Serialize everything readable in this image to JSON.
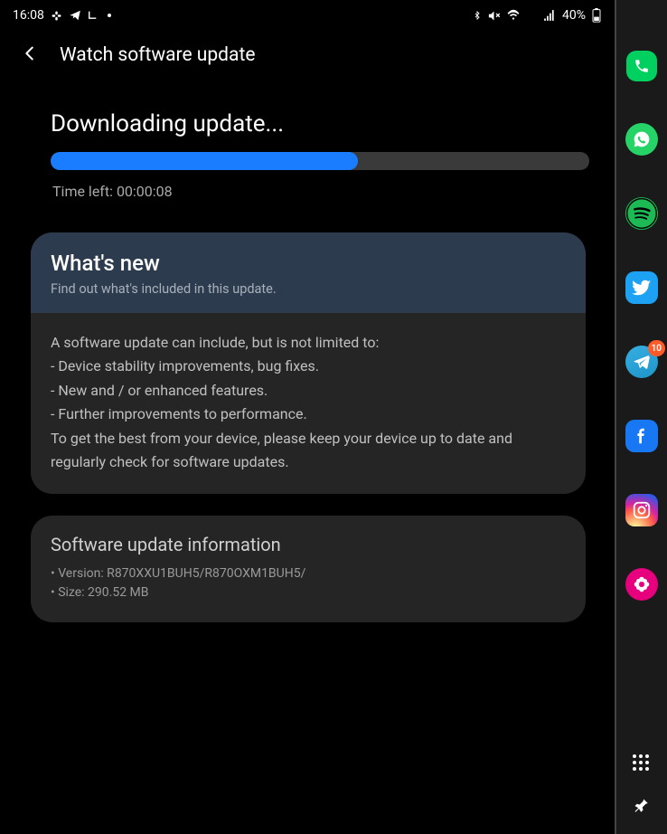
{
  "status_bar": {
    "time": "16:08",
    "battery": "40%"
  },
  "header": {
    "title": "Watch software update"
  },
  "download": {
    "title": "Downloading update...",
    "progress_percent": 57,
    "time_left_prefix": "Time left: ",
    "time_left": "00:00:08"
  },
  "whats_new": {
    "title": "What's new",
    "subtitle": "Find out what's included in this update.",
    "body_intro": "A software update can include, but is not limited to:",
    "bullet_1": " - Device stability improvements, bug fixes.",
    "bullet_2": " - New and / or enhanced features.",
    "bullet_3": " - Further improvements to performance.",
    "body_outro": "To get the best from your device, please keep your device up to date and regularly check for software updates."
  },
  "info": {
    "title": "Software update information",
    "version": "• Version: R870XXU1BUH5/R870OXM1BUH5/",
    "size": "• Size: 290.52 MB"
  },
  "sidebar": {
    "apps": {
      "phone": "Phone",
      "whatsapp": "WhatsApp",
      "spotify": "Spotify",
      "twitter": "Twitter",
      "telegram": "Telegram",
      "telegram_badge": "10",
      "facebook": "Facebook",
      "instagram": "Instagram",
      "gallery": "Gallery"
    }
  }
}
